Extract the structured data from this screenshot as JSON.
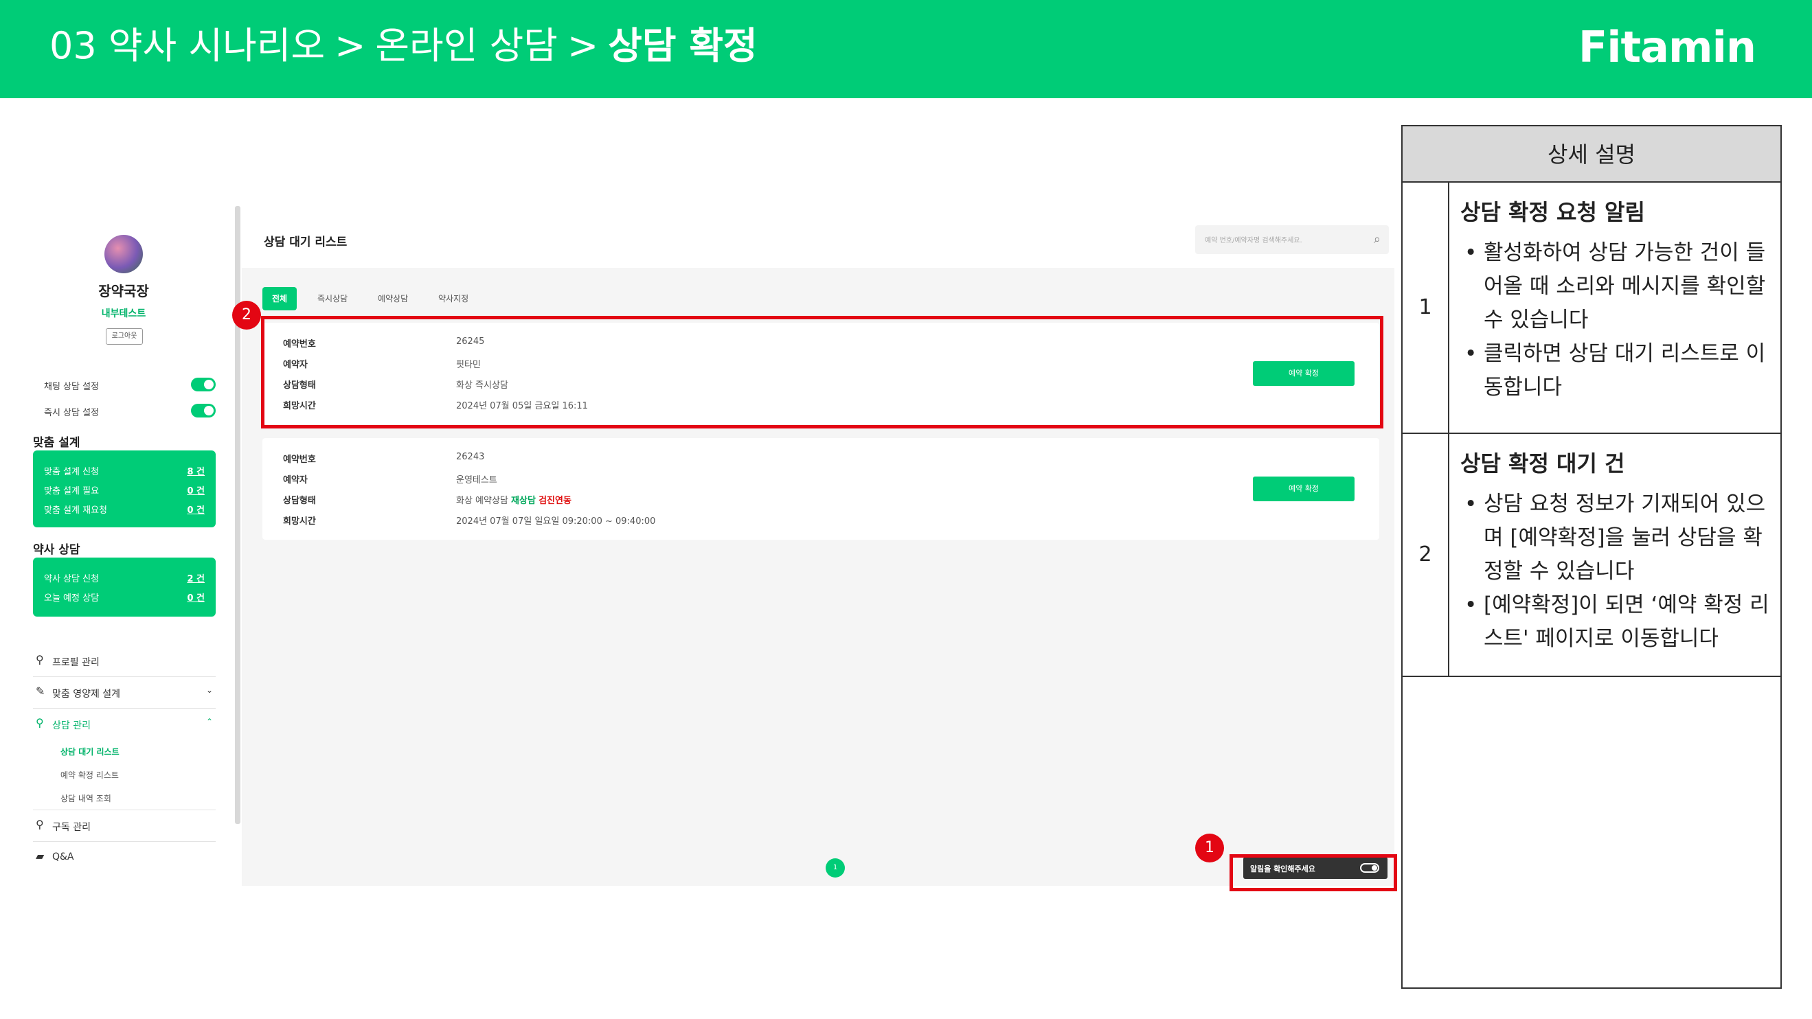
{
  "header": {
    "crumb1": "03 약사 시나리오",
    "crumb2": "온라인 상담",
    "crumb3": "상담 확정",
    "separator": ">",
    "brand": "Fitamin"
  },
  "sidebar": {
    "user_name": "장약국장",
    "user_sub": "내부테스트",
    "logout": "로그아웃",
    "toggles": [
      {
        "label": "채팅 상담 설정",
        "on": true
      },
      {
        "label": "즉시 상담 설정",
        "on": true
      }
    ],
    "custom_section": {
      "title": "맞춤 설계",
      "rows": [
        {
          "label": "맞춤 설계 신청",
          "value": "8 건"
        },
        {
          "label": "맞춤 설계 필요",
          "value": "0 건"
        },
        {
          "label": "맞춤 설계 재요청",
          "value": "0 건"
        }
      ]
    },
    "pharm_section": {
      "title": "약사 상담",
      "rows": [
        {
          "label": "약사 상담 신청",
          "value": "2 건"
        },
        {
          "label": "오늘 예정 상담",
          "value": "0 건"
        }
      ]
    },
    "nav": {
      "profile": "프로필 관리",
      "design": "맞춤 영양제 설계",
      "consult": "상담 관리",
      "sub": [
        "상담 대기 리스트",
        "예약 확정 리스트",
        "상담 내역 조회"
      ],
      "subscription": "구독 관리",
      "qna": "Q&A"
    }
  },
  "main": {
    "list_title": "상담 대기 리스트",
    "search_placeholder": "예약 번호/예약자명 검색해주세요.",
    "tabs": [
      "전체",
      "즉시상담",
      "예약상담",
      "약사지정"
    ],
    "field_labels": {
      "no": "예약번호",
      "name": "예약자",
      "type": "상담형태",
      "time": "희망시간"
    },
    "cards": [
      {
        "no": "26245",
        "name": "핏타민",
        "type": "화상 즉시상담",
        "time": "2024년 07월 05일 금요일 16:11",
        "button": "예약 확정"
      },
      {
        "no": "26243",
        "name": "운영테스트",
        "type_prefix": "화상 예약상담",
        "type_green": "재상담",
        "type_red": "검진연동",
        "time": "2024년 07월 07일 일요일 09:20:00 ~ 09:40:00",
        "button": "예약 확정"
      }
    ],
    "page": "1",
    "alarm_label": "알림을 확인해주세요"
  },
  "markers": [
    "1",
    "2"
  ],
  "description": {
    "header": "상세 설명",
    "rows": [
      {
        "num": "1",
        "title": "상담 확정 요청 알림",
        "bullets": [
          "활성화하여 상담 가능한 건이 들어올 때 소리와 메시지를 확인할 수 있습니다",
          "클릭하면 상담 대기 리스트로 이동합니다"
        ]
      },
      {
        "num": "2",
        "title": "상담 확정 대기 건",
        "bullets": [
          "상담 요청 정보가 기재되어 있으며 [예약확정]을 눌러 상담을 확정할 수 있습니다",
          "[예약확정]이 되면 ‘예약 확정 리스트' 페이지로 이동합니다"
        ]
      }
    ]
  },
  "colors": {
    "brand_green": "#00cc77",
    "marker_red": "#e30613"
  }
}
